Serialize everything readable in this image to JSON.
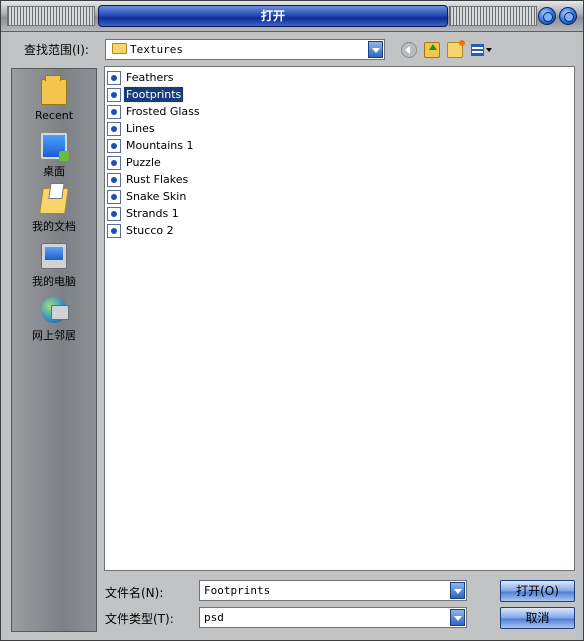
{
  "window": {
    "title": "打开"
  },
  "lookin": {
    "label": "查找范围(I):",
    "value": "Textures"
  },
  "places": [
    {
      "label": "Recent"
    },
    {
      "label": "桌面"
    },
    {
      "label": "我的文档"
    },
    {
      "label": "我的电脑"
    },
    {
      "label": "网上邻居"
    }
  ],
  "files": [
    {
      "name": "Feathers",
      "selected": false
    },
    {
      "name": "Footprints",
      "selected": true
    },
    {
      "name": "Frosted Glass",
      "selected": false
    },
    {
      "name": "Lines",
      "selected": false
    },
    {
      "name": "Mountains 1",
      "selected": false
    },
    {
      "name": "Puzzle",
      "selected": false
    },
    {
      "name": "Rust Flakes",
      "selected": false
    },
    {
      "name": "Snake Skin",
      "selected": false
    },
    {
      "name": "Strands 1",
      "selected": false
    },
    {
      "name": "Stucco 2",
      "selected": false
    }
  ],
  "filename": {
    "label": "文件名(N):",
    "value": "Footprints"
  },
  "filetype": {
    "label": "文件类型(T):",
    "value": "psd"
  },
  "buttons": {
    "open": "打开(O)",
    "cancel": "取消"
  },
  "icons": {
    "lookin_folder": "folder-icon",
    "back": "back-arrow-icon",
    "up": "up-folder-icon",
    "new_folder": "new-folder-icon",
    "view": "view-menu-icon",
    "file": "psd-file-icon"
  },
  "colors": {
    "selection": "#163c7a",
    "title_bar": "#1f46b8",
    "button": "#7ea6e8"
  }
}
